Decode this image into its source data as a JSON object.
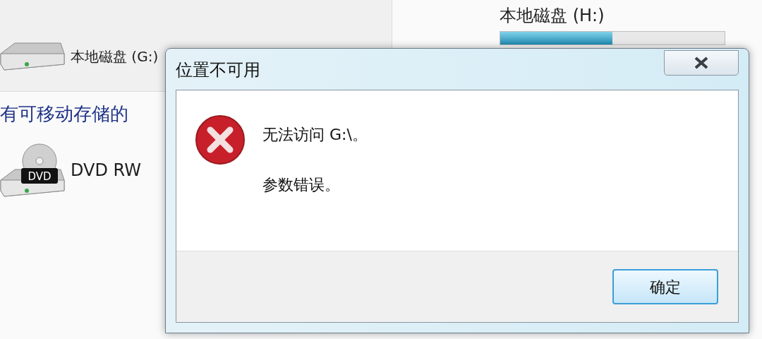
{
  "explorer": {
    "drives": [
      {
        "kind": "hdd",
        "name": "本地磁盘 (G:)"
      },
      {
        "name": "本地磁盘 (H:)",
        "level": 0.5
      }
    ],
    "section_header": "有可移动存储的",
    "removable": [
      {
        "kind": "dvd",
        "name": "DVD RW",
        "badge": "DVD"
      }
    ]
  },
  "dialog": {
    "title": "位置不可用",
    "messages": [
      "无法访问 G:\\。",
      "参数错误。"
    ],
    "buttons": [
      {
        "label": "确定",
        "selected": true
      }
    ]
  }
}
